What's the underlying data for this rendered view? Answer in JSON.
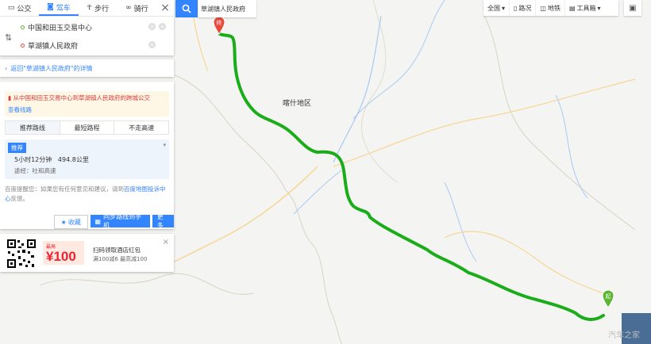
{
  "transport_modes": [
    {
      "label": "公交",
      "icon": "bus-icon"
    },
    {
      "label": "驾车",
      "icon": "car-icon",
      "active": true
    },
    {
      "label": "步行",
      "icon": "walk-icon"
    },
    {
      "label": "骑行",
      "icon": "bike-icon"
    }
  ],
  "route": {
    "origin": "中国和田玉交易中心",
    "destination": "草湖镇人民政府"
  },
  "back_link": "返回\"草湖镇人民政府\"的详情",
  "notice": {
    "text": "从中国和田玉交易中心到草湖镇人民政府的跨城公交",
    "link": "查看线路"
  },
  "strategies": [
    "推荐路线",
    "最短路程",
    "不走高速"
  ],
  "plan": {
    "tag": "推荐",
    "time": "5小时12分钟",
    "distance": "494.8公里",
    "via": "途经：吐和高速"
  },
  "tip": {
    "prefix": "百度提醒您：如果您有任何意见和建议，请到",
    "link": "百度地图投诉中心",
    "suffix": "反馈。"
  },
  "actions": {
    "favorite": "收藏",
    "sync": "同步路线到手机",
    "more": "更多"
  },
  "ad": {
    "coupon_small": "最高",
    "coupon_big": "¥100",
    "line1": "扫码领取酒店红包",
    "line2": "满100减6 最高减100"
  },
  "map": {
    "dest_box": "草湖镇人民政府",
    "region_label": "喀什地区",
    "start_marker": "起",
    "end_marker": "终",
    "toolbar": [
      "全国",
      "路况",
      "地铁",
      "工具箱"
    ],
    "watermark": "汽车之家",
    "route_color": "#1aad19"
  }
}
